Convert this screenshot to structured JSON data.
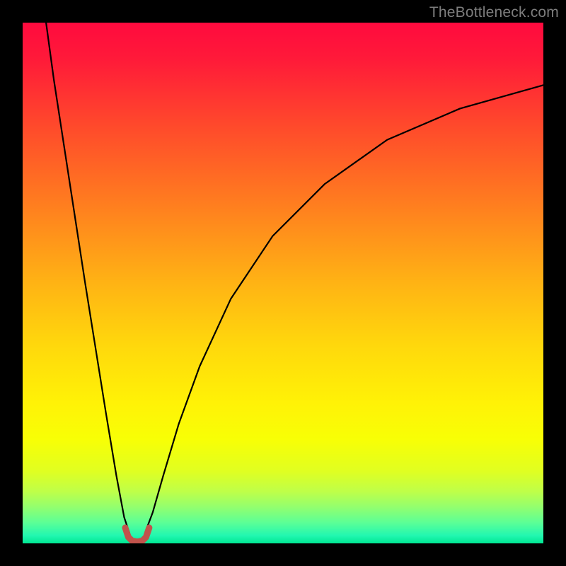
{
  "watermark": "TheBottleneck.com",
  "chart_data": {
    "type": "line",
    "title": "",
    "xlabel": "",
    "ylabel": "",
    "xlim": [
      0,
      100
    ],
    "ylim": [
      0,
      100
    ],
    "grid": false,
    "legend": false,
    "background_gradient": {
      "stops": [
        {
          "offset": 0.0,
          "color": "#ff0a3e"
        },
        {
          "offset": 0.07,
          "color": "#ff1a39"
        },
        {
          "offset": 0.2,
          "color": "#ff4a2b"
        },
        {
          "offset": 0.35,
          "color": "#ff7e1f"
        },
        {
          "offset": 0.5,
          "color": "#ffb314"
        },
        {
          "offset": 0.62,
          "color": "#ffd80c"
        },
        {
          "offset": 0.73,
          "color": "#fff206"
        },
        {
          "offset": 0.8,
          "color": "#f8ff05"
        },
        {
          "offset": 0.86,
          "color": "#e1ff20"
        },
        {
          "offset": 0.9,
          "color": "#bfff48"
        },
        {
          "offset": 0.93,
          "color": "#93ff6e"
        },
        {
          "offset": 0.96,
          "color": "#5cff96"
        },
        {
          "offset": 0.985,
          "color": "#22f7b0"
        },
        {
          "offset": 1.0,
          "color": "#00e893"
        }
      ]
    },
    "series": [
      {
        "name": "left-branch",
        "stroke": "#000000",
        "x": [
          4.5,
          6,
          8,
          10,
          12,
          14,
          16,
          18,
          19.5,
          20.5
        ],
        "y": [
          100,
          89,
          76,
          63,
          50,
          37.5,
          25,
          13,
          5,
          2
        ]
      },
      {
        "name": "right-branch",
        "stroke": "#000000",
        "x": [
          23.5,
          25,
          27,
          30,
          34,
          40,
          48,
          58,
          70,
          84,
          100
        ],
        "y": [
          2,
          6,
          13,
          23,
          34,
          47,
          59,
          69,
          77.5,
          83.5,
          88
        ]
      },
      {
        "name": "valley-floor",
        "stroke": "#c1534c",
        "stroke_width": 9,
        "x": [
          19.7,
          20.3,
          21.0,
          22.0,
          23.0,
          23.7,
          24.3
        ],
        "y": [
          3.0,
          1.2,
          0.5,
          0.3,
          0.5,
          1.2,
          3.0
        ]
      }
    ],
    "annotations": []
  }
}
